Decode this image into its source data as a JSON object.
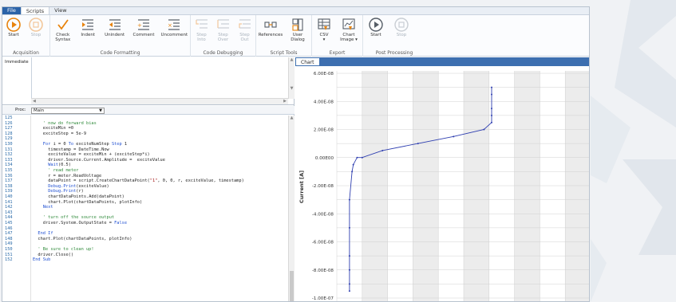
{
  "tabs": [
    {
      "label": "File"
    },
    {
      "label": "Scripts"
    },
    {
      "label": "View"
    }
  ],
  "ribbon": {
    "groups": [
      {
        "label": "Acquisition",
        "buttons": [
          {
            "label": "Start"
          },
          {
            "label": "Stop"
          }
        ]
      },
      {
        "label": "Code Formatting",
        "buttons": [
          {
            "label": "Check\nSyntax"
          },
          {
            "label": "Indent"
          },
          {
            "label": "Unindent"
          },
          {
            "label": "Comment"
          },
          {
            "label": "Uncomment"
          }
        ]
      },
      {
        "label": "Code Debugging",
        "buttons": [
          {
            "label": "Step\nInto"
          },
          {
            "label": "Step\nOver"
          },
          {
            "label": "Step\nOut"
          }
        ]
      },
      {
        "label": "Script Tools",
        "buttons": [
          {
            "label": "References"
          },
          {
            "label": "User\nDialog"
          }
        ]
      },
      {
        "label": "Export",
        "buttons": [
          {
            "label": "CSV\n▾"
          },
          {
            "label": "Chart\nImage ▾"
          }
        ]
      },
      {
        "label": "Post Processing",
        "buttons": [
          {
            "label": "Start"
          },
          {
            "label": "Stop"
          }
        ]
      }
    ]
  },
  "colors": {
    "accent": "#2b63a8",
    "icon_orange": "#e8830c",
    "icon_gray": "#555d66",
    "plot_line": "#2f3fb0"
  },
  "immediate": {
    "label": "Immediate"
  },
  "proc": {
    "label": "Proc:",
    "value": "Main"
  },
  "editor": {
    "lines": [
      {
        "n": "125",
        "indent": 0,
        "tokens": []
      },
      {
        "n": "126",
        "indent": 4,
        "tokens": [
          {
            "t": "' now do forward bias",
            "c": "cm"
          }
        ]
      },
      {
        "n": "127",
        "indent": 4,
        "tokens": [
          {
            "t": "exciteMin =0",
            "c": ""
          }
        ]
      },
      {
        "n": "128",
        "indent": 4,
        "tokens": [
          {
            "t": "exciteStep = 5e-9",
            "c": ""
          }
        ]
      },
      {
        "n": "129",
        "indent": 0,
        "tokens": []
      },
      {
        "n": "130",
        "indent": 4,
        "tokens": [
          {
            "t": "For",
            "c": "kw"
          },
          {
            "t": " i = 0 ",
            "c": ""
          },
          {
            "t": "To",
            "c": "kw"
          },
          {
            "t": " exciteNumStep ",
            "c": ""
          },
          {
            "t": "Step",
            "c": "kw"
          },
          {
            "t": " 1",
            "c": ""
          }
        ]
      },
      {
        "n": "131",
        "indent": 6,
        "tokens": [
          {
            "t": "timestamp = DateTime.Now",
            "c": ""
          }
        ]
      },
      {
        "n": "132",
        "indent": 6,
        "tokens": [
          {
            "t": "exciteValue = exciteMin + (exciteStep*i)",
            "c": ""
          }
        ]
      },
      {
        "n": "133",
        "indent": 6,
        "tokens": [
          {
            "t": "driver.Source.Current.Amplitude =  exciteValue",
            "c": ""
          }
        ]
      },
      {
        "n": "134",
        "indent": 6,
        "tokens": [
          {
            "t": "Wait",
            "c": "fn"
          },
          {
            "t": "(0.5)",
            "c": ""
          }
        ]
      },
      {
        "n": "135",
        "indent": 6,
        "tokens": [
          {
            "t": "' read meter",
            "c": "cm"
          }
        ]
      },
      {
        "n": "136",
        "indent": 6,
        "tokens": [
          {
            "t": "r = meter.ReadVoltage",
            "c": ""
          }
        ]
      },
      {
        "n": "137",
        "indent": 6,
        "tokens": [
          {
            "t": "dataPoint = script.CreateChartDataPoint(",
            "c": ""
          },
          {
            "t": "\"1\"",
            "c": "str"
          },
          {
            "t": ", 0, 0, r, exciteValue, timestamp)",
            "c": ""
          }
        ]
      },
      {
        "n": "138",
        "indent": 6,
        "tokens": [
          {
            "t": "Debug.Print",
            "c": "fn"
          },
          {
            "t": "(exciteValue)",
            "c": ""
          }
        ]
      },
      {
        "n": "139",
        "indent": 6,
        "tokens": [
          {
            "t": "Debug.Print",
            "c": "fn"
          },
          {
            "t": "(r)",
            "c": ""
          }
        ]
      },
      {
        "n": "140",
        "indent": 6,
        "tokens": [
          {
            "t": "chartDataPoints.Add(dataPoint)",
            "c": ""
          }
        ]
      },
      {
        "n": "141",
        "indent": 6,
        "tokens": [
          {
            "t": "chart.Plot(chartDataPoints, plotInfo)",
            "c": ""
          }
        ]
      },
      {
        "n": "142",
        "indent": 4,
        "tokens": [
          {
            "t": "Next",
            "c": "kw"
          }
        ]
      },
      {
        "n": "143",
        "indent": 0,
        "tokens": []
      },
      {
        "n": "144",
        "indent": 4,
        "tokens": [
          {
            "t": "' turn off the source output",
            "c": "cm"
          }
        ]
      },
      {
        "n": "145",
        "indent": 4,
        "tokens": [
          {
            "t": "driver.System.OutputState = ",
            "c": ""
          },
          {
            "t": "False",
            "c": "kw"
          }
        ]
      },
      {
        "n": "146",
        "indent": 0,
        "tokens": []
      },
      {
        "n": "147",
        "indent": 2,
        "tokens": [
          {
            "t": "End If",
            "c": "kw"
          }
        ]
      },
      {
        "n": "148",
        "indent": 2,
        "tokens": [
          {
            "t": "chart.Plot(chartDataPoints, plotInfo)",
            "c": ""
          }
        ]
      },
      {
        "n": "149",
        "indent": 0,
        "tokens": []
      },
      {
        "n": "150",
        "indent": 2,
        "tokens": [
          {
            "t": "' Be sure to clean up!",
            "c": "cm"
          }
        ]
      },
      {
        "n": "151",
        "indent": 2,
        "tokens": [
          {
            "t": "driver.Close()",
            "c": ""
          }
        ]
      },
      {
        "n": "152",
        "indent": 0,
        "tokens": [
          {
            "t": "End Sub",
            "c": "kw"
          }
        ]
      }
    ]
  },
  "chart_panel": {
    "tab_label": "Chart"
  },
  "chart_data": {
    "type": "line",
    "ylabel": "Current [A]",
    "xlabel": "",
    "ylim": [
      -1e-07,
      6e-08
    ],
    "xlim": [
      0,
      10
    ],
    "y_ticks": [
      "6.00E-08",
      "4.00E-08",
      "2.00E-08",
      "0.00E00",
      "-2.00E-08",
      "-4.00E-08",
      "-6.00E-08",
      "-8.00E-08",
      "-1.00E-07"
    ],
    "y_tick_values": [
      6e-08,
      4e-08,
      2e-08,
      0,
      -2e-08,
      -4e-08,
      -6e-08,
      -8e-08,
      -1e-07
    ],
    "grid": true,
    "series": [
      {
        "x": [
          0.5,
          0.5,
          0.5,
          0.5,
          0.5,
          0.5,
          0.6,
          0.65,
          0.8,
          1.0,
          1.8,
          3.2,
          4.6,
          5.8,
          6.1,
          6.1,
          6.1,
          6.1,
          6.1
        ],
        "y": [
          -9.5e-08,
          -9e-08,
          -8e-08,
          -7e-08,
          -5e-08,
          -3e-08,
          -1e-08,
          -5e-09,
          0,
          0,
          5e-09,
          1e-08,
          1.5e-08,
          2e-08,
          2.5e-08,
          3e-08,
          3.5e-08,
          4.5e-08,
          5e-08
        ]
      }
    ]
  }
}
